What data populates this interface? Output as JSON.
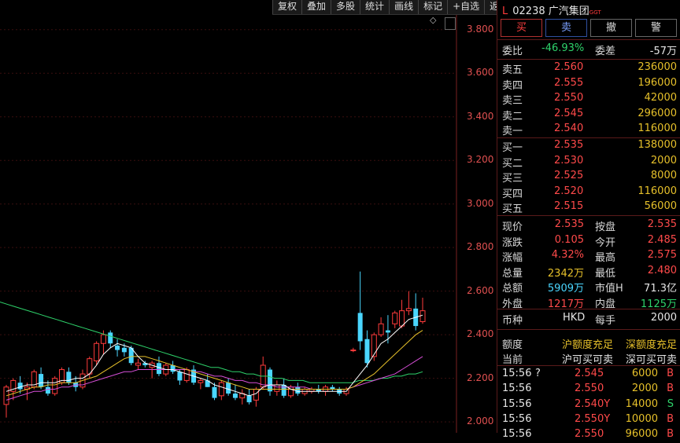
{
  "toolbar": [
    "复权",
    "叠加",
    "多股",
    "统计",
    "画线",
    "标记",
    "+自选",
    "返回"
  ],
  "axis": {
    "labels": [
      "3.800",
      "3.600",
      "3.400",
      "3.200",
      "3.000",
      "2.800",
      "2.600",
      "2.400",
      "2.200",
      "2.000"
    ],
    "min": 1.95,
    "max": 3.9,
    "color": "#e05050"
  },
  "colors": {
    "up": "#ff3b3b",
    "down": "#4ad6ff",
    "ma5": "#ffffff",
    "ma10": "#e6c02a",
    "ma20": "#d84fd8",
    "ma60": "#2ed36b",
    "grid": "#3a0f0f"
  },
  "candles": [
    [
      2.08,
      2.17,
      2.02,
      2.16
    ],
    [
      2.14,
      2.2,
      2.1,
      2.19
    ],
    [
      2.18,
      2.21,
      2.13,
      2.15
    ],
    [
      2.15,
      2.18,
      2.1,
      2.16
    ],
    [
      2.16,
      2.24,
      2.15,
      2.23
    ],
    [
      2.22,
      2.25,
      2.15,
      2.16
    ],
    [
      2.16,
      2.19,
      2.12,
      2.13
    ],
    [
      2.13,
      2.21,
      2.12,
      2.2
    ],
    [
      2.18,
      2.25,
      2.17,
      2.24
    ],
    [
      2.23,
      2.25,
      2.17,
      2.18
    ],
    [
      2.18,
      2.21,
      2.14,
      2.16
    ],
    [
      2.16,
      2.24,
      2.15,
      2.22
    ],
    [
      2.22,
      2.3,
      2.2,
      2.29
    ],
    [
      2.28,
      2.37,
      2.26,
      2.36
    ],
    [
      2.36,
      2.42,
      2.31,
      2.4
    ],
    [
      2.41,
      2.42,
      2.34,
      2.36
    ],
    [
      2.35,
      2.38,
      2.3,
      2.33
    ],
    [
      2.34,
      2.36,
      2.3,
      2.32
    ],
    [
      2.34,
      2.35,
      2.26,
      2.27
    ],
    [
      2.26,
      2.29,
      2.24,
      2.27
    ],
    [
      2.27,
      2.28,
      2.25,
      2.26
    ],
    [
      2.25,
      2.28,
      2.2,
      2.27
    ],
    [
      2.27,
      2.3,
      2.21,
      2.22
    ],
    [
      2.22,
      2.27,
      2.21,
      2.26
    ],
    [
      2.26,
      2.28,
      2.22,
      2.23
    ],
    [
      2.23,
      2.24,
      2.17,
      2.19
    ],
    [
      2.19,
      2.25,
      2.18,
      2.24
    ],
    [
      2.24,
      2.26,
      2.17,
      2.18
    ],
    [
      2.18,
      2.2,
      2.15,
      2.19
    ],
    [
      2.19,
      2.22,
      2.16,
      2.16
    ],
    [
      2.16,
      2.18,
      2.1,
      2.11
    ],
    [
      2.12,
      2.19,
      2.1,
      2.18
    ],
    [
      2.18,
      2.2,
      2.12,
      2.13
    ],
    [
      2.13,
      2.17,
      2.1,
      2.11
    ],
    [
      2.11,
      2.15,
      2.08,
      2.13
    ],
    [
      2.12,
      2.15,
      2.08,
      2.09
    ],
    [
      2.1,
      2.16,
      2.07,
      2.15
    ],
    [
      2.16,
      2.3,
      2.15,
      2.26
    ],
    [
      2.24,
      2.25,
      2.12,
      2.14
    ],
    [
      2.14,
      2.19,
      2.12,
      2.17
    ],
    [
      2.17,
      2.2,
      2.11,
      2.12
    ],
    [
      2.12,
      2.17,
      2.11,
      2.16
    ],
    [
      2.16,
      2.18,
      2.12,
      2.13
    ],
    [
      2.13,
      2.16,
      2.12,
      2.15
    ],
    [
      2.14,
      2.16,
      2.13,
      2.15
    ],
    [
      2.15,
      2.17,
      2.13,
      2.14
    ],
    [
      2.14,
      2.17,
      2.12,
      2.16
    ],
    [
      2.16,
      2.17,
      2.14,
      2.15
    ],
    [
      2.15,
      2.16,
      2.12,
      2.13
    ],
    [
      2.13,
      2.16,
      2.12,
      2.15
    ],
    [
      2.33,
      2.34,
      2.32,
      2.33
    ],
    [
      2.5,
      2.69,
      2.33,
      2.37
    ],
    [
      2.38,
      2.42,
      2.25,
      2.27
    ],
    [
      2.3,
      2.41,
      2.28,
      2.4
    ],
    [
      2.4,
      2.48,
      2.39,
      2.45
    ],
    [
      2.42,
      2.49,
      2.36,
      2.41
    ],
    [
      2.45,
      2.51,
      2.43,
      2.5
    ],
    [
      2.44,
      2.56,
      2.43,
      2.51
    ],
    [
      2.51,
      2.6,
      2.49,
      2.52
    ],
    [
      2.52,
      2.59,
      2.42,
      2.44
    ],
    [
      2.46,
      2.57,
      2.45,
      2.51
    ]
  ],
  "ma5": [
    2.14,
    2.15,
    2.16,
    2.17,
    2.17,
    2.18,
    2.18,
    2.18,
    2.19,
    2.19,
    2.2,
    2.2,
    2.22,
    2.26,
    2.31,
    2.34,
    2.36,
    2.35,
    2.34,
    2.3,
    2.27,
    2.26,
    2.25,
    2.24,
    2.24,
    2.23,
    2.22,
    2.21,
    2.2,
    2.19,
    2.17,
    2.16,
    2.15,
    2.14,
    2.13,
    2.12,
    2.13,
    2.16,
    2.17,
    2.17,
    2.17,
    2.15,
    2.14,
    2.14,
    2.14,
    2.14,
    2.14,
    2.14,
    2.14,
    2.14,
    2.18,
    2.22,
    2.26,
    2.31,
    2.36,
    2.38,
    2.41,
    2.44,
    2.47,
    2.48,
    2.49
  ],
  "ma10": [
    2.12,
    2.13,
    2.14,
    2.15,
    2.16,
    2.16,
    2.17,
    2.17,
    2.18,
    2.18,
    2.18,
    2.19,
    2.2,
    2.21,
    2.23,
    2.25,
    2.27,
    2.29,
    2.3,
    2.3,
    2.3,
    2.29,
    2.28,
    2.27,
    2.26,
    2.25,
    2.24,
    2.23,
    2.22,
    2.21,
    2.2,
    2.19,
    2.18,
    2.17,
    2.16,
    2.15,
    2.15,
    2.15,
    2.15,
    2.15,
    2.15,
    2.15,
    2.15,
    2.15,
    2.15,
    2.15,
    2.15,
    2.15,
    2.15,
    2.15,
    2.16,
    2.18,
    2.2,
    2.22,
    2.25,
    2.28,
    2.31,
    2.34,
    2.37,
    2.4,
    2.42
  ],
  "ma20": [
    2.1,
    2.11,
    2.12,
    2.13,
    2.14,
    2.14,
    2.15,
    2.15,
    2.16,
    2.16,
    2.17,
    2.17,
    2.18,
    2.19,
    2.2,
    2.21,
    2.22,
    2.23,
    2.23,
    2.24,
    2.24,
    2.24,
    2.24,
    2.24,
    2.24,
    2.24,
    2.24,
    2.23,
    2.23,
    2.22,
    2.21,
    2.21,
    2.2,
    2.19,
    2.19,
    2.18,
    2.18,
    2.17,
    2.17,
    2.16,
    2.16,
    2.16,
    2.16,
    2.16,
    2.15,
    2.15,
    2.15,
    2.15,
    2.15,
    2.15,
    2.16,
    2.17,
    2.18,
    2.19,
    2.2,
    2.21,
    2.22,
    2.24,
    2.26,
    2.28,
    2.3
  ],
  "ma60": [
    2.55,
    2.54,
    2.53,
    2.52,
    2.51,
    2.5,
    2.49,
    2.48,
    2.47,
    2.46,
    2.45,
    2.44,
    2.43,
    2.42,
    2.41,
    2.4,
    2.39,
    2.38,
    2.37,
    2.36,
    2.35,
    2.34,
    2.33,
    2.32,
    2.31,
    2.3,
    2.29,
    2.28,
    2.27,
    2.26,
    2.25,
    2.25,
    2.24,
    2.23,
    2.23,
    2.22,
    2.22,
    2.21,
    2.21,
    2.2,
    2.2,
    2.19,
    2.19,
    2.19,
    2.18,
    2.18,
    2.18,
    2.18,
    2.18,
    2.18,
    2.18,
    2.19,
    2.19,
    2.19,
    2.2,
    2.2,
    2.21,
    2.21,
    2.22,
    2.22,
    2.23
  ],
  "header": {
    "mark": "L",
    "code": "02238",
    "name": "广汽集团",
    "tag": "GGT"
  },
  "buttons": {
    "buy": "买",
    "sell": "卖",
    "cancel": "撤",
    "alert": "警"
  },
  "weibi": {
    "label": "委比",
    "value": "-46.93%",
    "diff_label": "委差",
    "diff_value": "-57万"
  },
  "asks": [
    {
      "label": "卖五",
      "price": "2.560",
      "vol": "236000"
    },
    {
      "label": "卖四",
      "price": "2.555",
      "vol": "196000"
    },
    {
      "label": "卖三",
      "price": "2.550",
      "vol": "42000"
    },
    {
      "label": "卖二",
      "price": "2.545",
      "vol": "296000"
    },
    {
      "label": "卖一",
      "price": "2.540",
      "vol": "116000"
    }
  ],
  "bids": [
    {
      "label": "买一",
      "price": "2.535",
      "vol": "138000"
    },
    {
      "label": "买二",
      "price": "2.530",
      "vol": "2000"
    },
    {
      "label": "买三",
      "price": "2.525",
      "vol": "8000"
    },
    {
      "label": "买四",
      "price": "2.520",
      "vol": "116000"
    },
    {
      "label": "买五",
      "price": "2.515",
      "vol": "56000"
    }
  ],
  "stats": [
    {
      "l1": "现价",
      "v1": "2.535",
      "c1": "red",
      "l2": "按盘",
      "v2": "2.535",
      "c2": "red"
    },
    {
      "l1": "涨跌",
      "v1": "0.105",
      "c1": "red",
      "l2": "今开",
      "v2": "2.485",
      "c2": "red"
    },
    {
      "l1": "涨幅",
      "v1": "4.32%",
      "c1": "red",
      "l2": "最高",
      "v2": "2.575",
      "c2": "red"
    },
    {
      "l1": "总量",
      "v1": "2342万",
      "c1": "yellow",
      "l2": "最低",
      "v2": "2.480",
      "c2": "red"
    },
    {
      "l1": "总额",
      "v1": "5909万",
      "c1": "cyan",
      "l2": "市值H",
      "v2": "71.3亿",
      "c2": "white"
    },
    {
      "l1": "外盘",
      "v1": "1217万",
      "c1": "red",
      "l2": "内盘",
      "v2": "1125万",
      "c2": "green"
    }
  ],
  "currency": {
    "label": "币种",
    "value": "HKD",
    "lot_label": "每手",
    "lot_value": "2000"
  },
  "quota": {
    "label": "额度",
    "sh": "沪额度充足",
    "sz": "深额度充足",
    "now_label": "当前",
    "sh_now": "沪可买可卖",
    "sz_now": "深可买可卖"
  },
  "ticks": [
    {
      "time": "15:56",
      "flag": "?",
      "price": "2.545",
      "vol": "6000",
      "side": "B"
    },
    {
      "time": "15:56",
      "flag": "",
      "price": "2.550",
      "vol": "2000",
      "side": "B"
    },
    {
      "time": "15:56",
      "flag": "",
      "price": "2.540Y",
      "vol": "14000",
      "side": "S"
    },
    {
      "time": "15:56",
      "flag": "",
      "price": "2.550Y",
      "vol": "10000",
      "side": "B"
    },
    {
      "time": "15:56",
      "flag": "",
      "price": "2.550",
      "vol": "96000",
      "side": "B"
    }
  ]
}
